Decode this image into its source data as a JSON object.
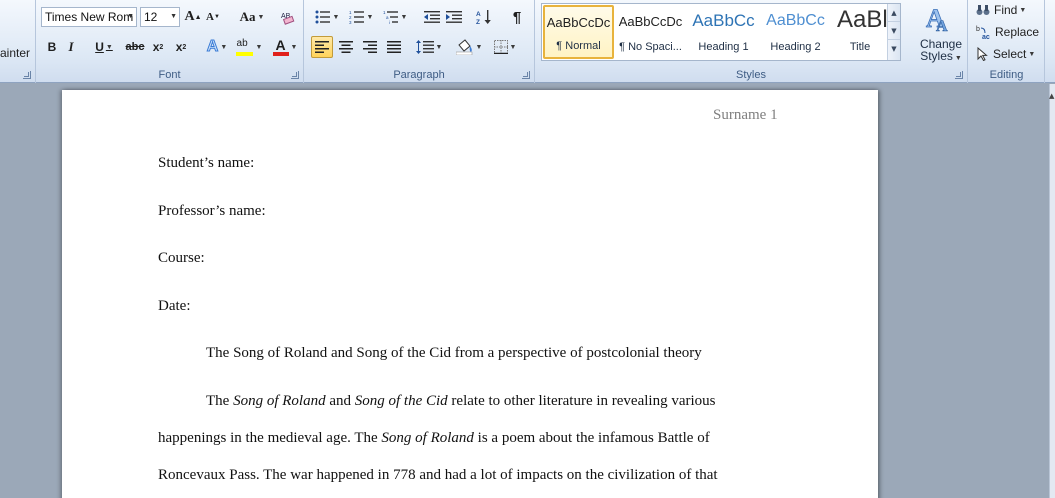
{
  "ribbon": {
    "clipboard": {
      "format_painter_label": "ainter"
    },
    "font": {
      "group_label": "Font",
      "font_name": "Times New Rom",
      "font_size": "12",
      "grow_label": "A",
      "shrink_label": "A",
      "change_case_label": "Aa",
      "bold_label": "B",
      "italic_label": "I",
      "underline_label": "U",
      "strike_label": "abc",
      "subscript_label": "x",
      "superscript_label": "x",
      "text_effects_label": "A",
      "highlight_label": "ab",
      "font_color_label": "A",
      "font_color": "#e0201b",
      "highlight_color": "#ffff00"
    },
    "paragraph": {
      "group_label": "Paragraph",
      "pilcrow_label": "¶"
    },
    "styles": {
      "group_label": "Styles",
      "items": [
        {
          "preview": "AaBbCcDc",
          "name": "¶ Normal",
          "selected": true
        },
        {
          "preview": "AaBbCcDc",
          "name": "¶ No Spaci...",
          "selected": false
        },
        {
          "preview": "AaBbCc",
          "name": "Heading 1",
          "selected": false
        },
        {
          "preview": "AaBbCc",
          "name": "Heading 2",
          "selected": false
        },
        {
          "preview": "AaBl",
          "name": "Title",
          "selected": false
        }
      ],
      "change_styles_line1": "Change",
      "change_styles_line2": "Styles",
      "heading_color": "#2e74b5"
    },
    "editing": {
      "group_label": "Editing",
      "find_label": "Find",
      "replace_label": "Replace",
      "select_label": "Select"
    }
  },
  "document": {
    "header": "Surname 1",
    "lines": {
      "student": "Student’s name:",
      "professor": "Professor’s name:",
      "course": "Course:",
      "date": "Date:",
      "title": "The Song of Roland and Song of the Cid from a perspective of postcolonial theory"
    },
    "p1": {
      "a": "The ",
      "b": "Song of Roland",
      "c": " and ",
      "d": "Song of the Cid",
      "e": " relate to other literature in revealing  various"
    },
    "p2": {
      "a": "happenings in the medieval age. The ",
      "b": "Song of Roland",
      "c": " is a poem about the infamous Battle of"
    },
    "p3": "Roncevaux Pass. The war happened in 778 and had a lot of impacts  on the civilization  of that"
  }
}
